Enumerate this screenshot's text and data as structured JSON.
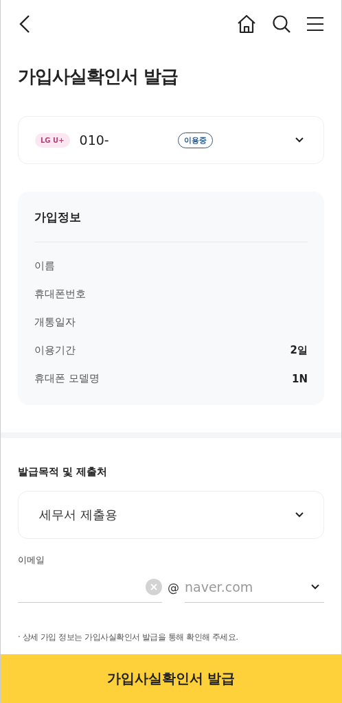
{
  "header": {
    "title": "가입사실확인서 발급"
  },
  "line": {
    "carrier": "LG U+",
    "number": "010-",
    "status": "이용중"
  },
  "info": {
    "title": "가입정보",
    "rows": [
      {
        "label": "이름"
      },
      {
        "label": "휴대폰번호"
      },
      {
        "label": "개통일자"
      },
      {
        "label": "이용기간",
        "value": "2일"
      },
      {
        "label": "휴대폰 모델명",
        "value": "1N"
      }
    ]
  },
  "purpose": {
    "label": "발급목적 및 제출처",
    "value": "세무서 제출용"
  },
  "email": {
    "label": "이메일",
    "at": "@",
    "domain": "naver.com"
  },
  "note": "· 상세 가입 정보는 가입사실확인서 발급을 통해 확인해 주세요.",
  "submit": "가입사실확인서 발급"
}
